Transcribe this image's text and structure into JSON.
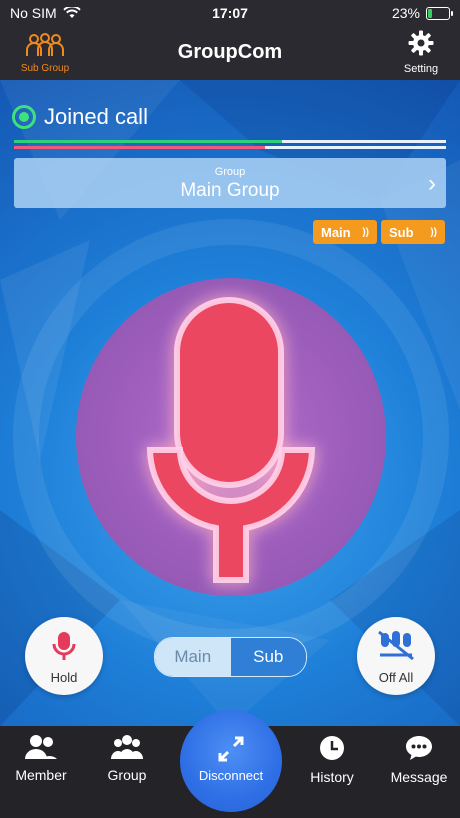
{
  "status": {
    "carrier": "No SIM",
    "time": "17:07",
    "battery": "23%"
  },
  "header": {
    "title": "GroupCom",
    "left_label": "Sub Group",
    "right_label": "Setting"
  },
  "call": {
    "status": "Joined call",
    "green_level": 0.62,
    "red_level": 0.58
  },
  "group": {
    "caption": "Group",
    "name": "Main Group"
  },
  "chips": {
    "main": "Main",
    "sub": "Sub"
  },
  "controls": {
    "hold": "Hold",
    "off_all": "Off All",
    "toggle_main": "Main",
    "toggle_sub": "Sub",
    "selected": "Sub"
  },
  "tabbar": {
    "member": "Member",
    "group": "Group",
    "disconnect": "Disconnect",
    "history": "History",
    "message": "Message"
  },
  "colors": {
    "accent": "#f39a1f",
    "mic": "#e63a5c",
    "blue": "#1e7fd8"
  }
}
